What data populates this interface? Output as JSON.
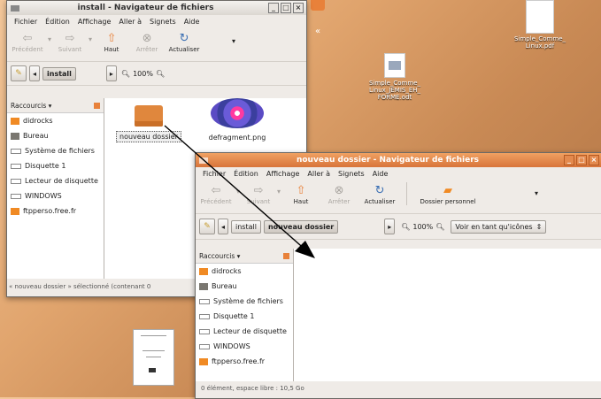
{
  "desktop": {
    "icons": [
      {
        "label": "Simple_Comme_\nLinux.pdf"
      },
      {
        "label": "Simple_Comme_\nLinux_JEMIS_EH_\nFORME.odt"
      }
    ],
    "guillemet": "«"
  },
  "window1": {
    "title": "install - Navigateur de fichiers",
    "menu": [
      "Fichier",
      "Édition",
      "Affichage",
      "Aller à",
      "Signets",
      "Aide"
    ],
    "toolbar": {
      "back": "Précédent",
      "forward": "Suivant",
      "up": "Haut",
      "stop": "Arrêter",
      "reload": "Actualiser"
    },
    "path": {
      "current": "install",
      "zoom": "100%"
    },
    "sidebar_header": "Raccourcis ▾",
    "sidebar": [
      "didrocks",
      "Bureau",
      "Système de fichiers",
      "Disquette 1",
      "Lecteur de disquette",
      "WINDOWS",
      "ftpperso.free.fr"
    ],
    "files": [
      {
        "name": "nouveau dossier"
      },
      {
        "name": "defragment.png"
      }
    ],
    "status": "« nouveau dossier » sélectionné (contenant 0"
  },
  "window2": {
    "title": "nouveau dossier - Navigateur de fichiers",
    "menu": [
      "Fichier",
      "Édition",
      "Affichage",
      "Aller à",
      "Signets",
      "Aide"
    ],
    "toolbar": {
      "back": "Précédent",
      "forward": "Suivant",
      "up": "Haut",
      "stop": "Arrêter",
      "reload": "Actualiser",
      "home": "Dossier personnel"
    },
    "path": {
      "parent": "install",
      "current": "nouveau dossier",
      "zoom": "100%",
      "view": "Voir en tant qu'icônes"
    },
    "sidebar_header": "Raccourcis ▾",
    "sidebar": [
      "didrocks",
      "Bureau",
      "Système de fichiers",
      "Disquette 1",
      "Lecteur de disquette",
      "WINDOWS",
      "ftpperso.free.fr"
    ],
    "status": "0 élément, espace libre : 10,5 Go"
  },
  "colors": {
    "title_active": "#e8813a",
    "folder": "#e0873d",
    "home_icon": "#f08a24"
  }
}
